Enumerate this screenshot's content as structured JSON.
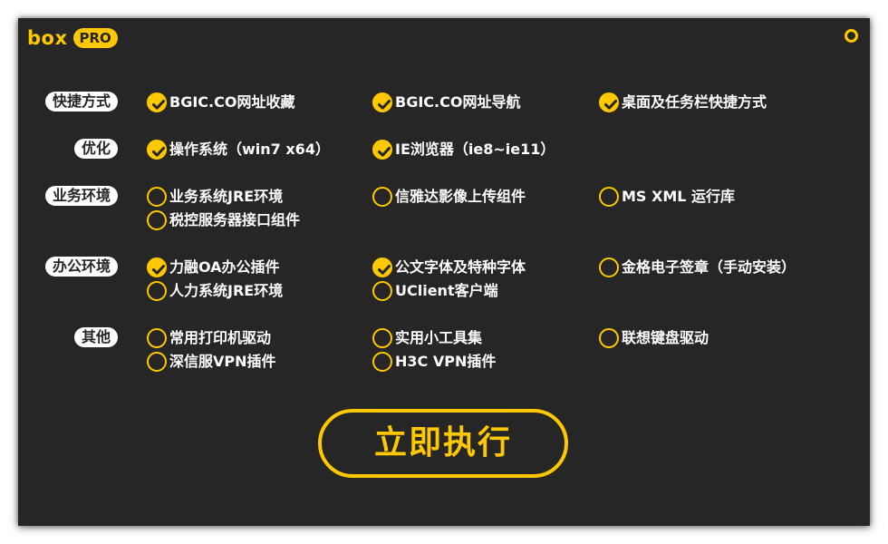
{
  "app": {
    "logo_text": "box",
    "logo_badge": "PRO"
  },
  "colors": {
    "accent": "#ffc800",
    "background": "#262626",
    "text": "#ffffff"
  },
  "categories": [
    {
      "label": "快捷方式",
      "options": [
        {
          "label": "BGIC.CO网址收藏",
          "checked": true
        },
        {
          "label": "BGIC.CO网址导航",
          "checked": true
        },
        {
          "label": "桌面及任务栏快捷方式",
          "checked": true
        }
      ]
    },
    {
      "label": "优化",
      "options": [
        {
          "label": "操作系统（win7 x64）",
          "checked": true
        },
        {
          "label": "IE浏览器（ie8~ie11）",
          "checked": true
        }
      ]
    },
    {
      "label": "业务环境",
      "options": [
        {
          "label": "业务系统JRE环境",
          "checked": false
        },
        {
          "label": "信雅达影像上传组件",
          "checked": false
        },
        {
          "label": "MS XML 运行库",
          "checked": false
        },
        {
          "label": "税控服务器接口组件",
          "checked": false
        }
      ]
    },
    {
      "label": "办公环境",
      "options": [
        {
          "label": "力融OA办公插件",
          "checked": true
        },
        {
          "label": "公文字体及特种字体",
          "checked": true
        },
        {
          "label": "金格电子签章（手动安装）",
          "checked": false
        },
        {
          "label": "人力系统JRE环境",
          "checked": false
        },
        {
          "label": "UClient客户端",
          "checked": false
        }
      ]
    },
    {
      "label": "其他",
      "options": [
        {
          "label": "常用打印机驱动",
          "checked": false
        },
        {
          "label": "实用小工具集",
          "checked": false
        },
        {
          "label": "联想键盘驱动",
          "checked": false
        },
        {
          "label": "深信服VPN插件",
          "checked": false
        },
        {
          "label": "H3C VPN插件",
          "checked": false
        }
      ]
    }
  ],
  "run_button_label": "立即执行"
}
